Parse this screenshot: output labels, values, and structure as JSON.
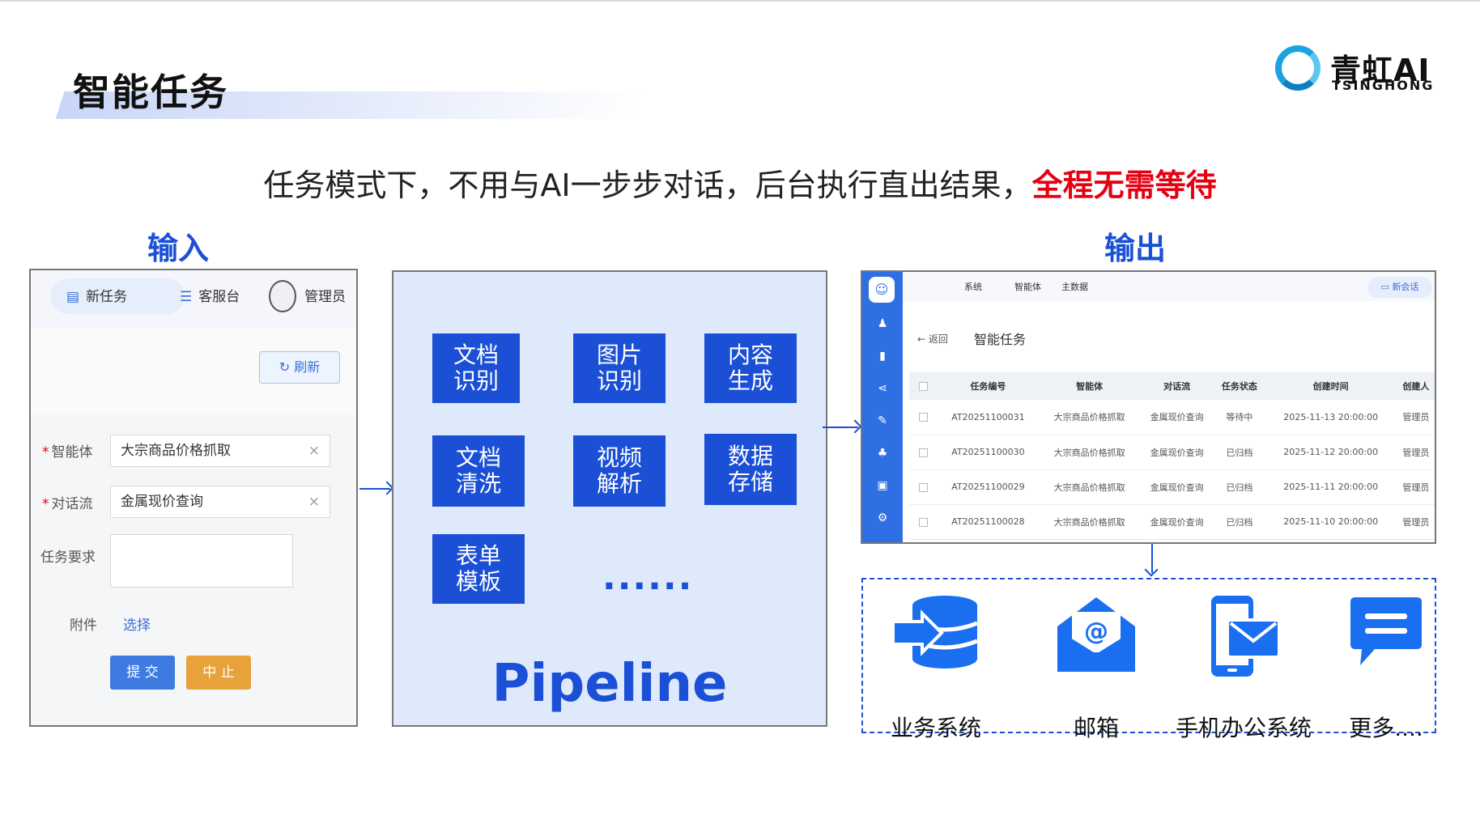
{
  "page": {
    "title": "智能任务",
    "subtitle_plain": "任务模式下，不用与AI一步步对话，后台执行直出结果，",
    "subtitle_emphasis": "全程无需等待",
    "logo_cn": "青虹AI",
    "logo_en": "TSINGHONG"
  },
  "colors": {
    "accent": "#1a4fd6",
    "emphasis": "#e60012",
    "panel_bg": "#deeafb"
  },
  "input_section": {
    "label": "输入",
    "tabs": [
      {
        "label": "新任务",
        "icon": "document-icon"
      },
      {
        "label": "客服台",
        "icon": "sliders-icon"
      },
      {
        "label": "管理员",
        "icon": "avatar-icon"
      }
    ],
    "refresh_label": "刷新",
    "form": {
      "agent_label": "智能体",
      "agent_value": "大宗商品价格抓取",
      "flow_label": "对话流",
      "flow_value": "金属现价查询",
      "requirement_label": "任务要求",
      "attachment_label": "附件",
      "attachment_action": "选择",
      "submit_label": "提 交",
      "stop_label": "中 止",
      "clear_symbol": "×"
    }
  },
  "pipeline_section": {
    "tiles": [
      "文档识别",
      "图片识别",
      "内容生成",
      "文档清洗",
      "视频解析",
      "数据存储",
      "表单模板"
    ],
    "tile_lines": [
      [
        "文档",
        "识别"
      ],
      [
        "图片",
        "识别"
      ],
      [
        "内容",
        "生成"
      ],
      [
        "文档",
        "清洗"
      ],
      [
        "视频",
        "解析"
      ],
      [
        "数据",
        "存储"
      ],
      [
        "表单",
        "模板"
      ]
    ],
    "ellipsis": "......",
    "label": "Pipeline"
  },
  "output_section": {
    "label": "输出",
    "nav": [
      "系统",
      "智能体",
      "主数据"
    ],
    "new_chat_label": "新会话",
    "back_label": "返回",
    "page_title": "智能任务",
    "columns": [
      "任务编号",
      "智能体",
      "对话流",
      "任务状态",
      "创建时间",
      "创建人"
    ],
    "rows": [
      [
        "AT20251100031",
        "大宗商品价格抓取",
        "金属现价查询",
        "等待中",
        "2025-11-13 20:00:00",
        "管理员"
      ],
      [
        "AT20251100030",
        "大宗商品价格抓取",
        "金属现价查询",
        "已归档",
        "2025-11-12 20:00:00",
        "管理员"
      ],
      [
        "AT20251100029",
        "大宗商品价格抓取",
        "金属现价查询",
        "已归档",
        "2025-11-11 20:00:00",
        "管理员"
      ],
      [
        "AT20251100028",
        "大宗商品价格抓取",
        "金属现价查询",
        "已归档",
        "2025-11-10 20:00:00",
        "管理员"
      ]
    ],
    "channels": [
      {
        "label": "业务系统",
        "icon": "database-icon"
      },
      {
        "label": "邮箱",
        "icon": "email-icon"
      },
      {
        "label": "手机办公系统",
        "icon": "mobile-mail-icon"
      },
      {
        "label": "更多....",
        "icon": "chat-bubble-icon"
      }
    ]
  }
}
